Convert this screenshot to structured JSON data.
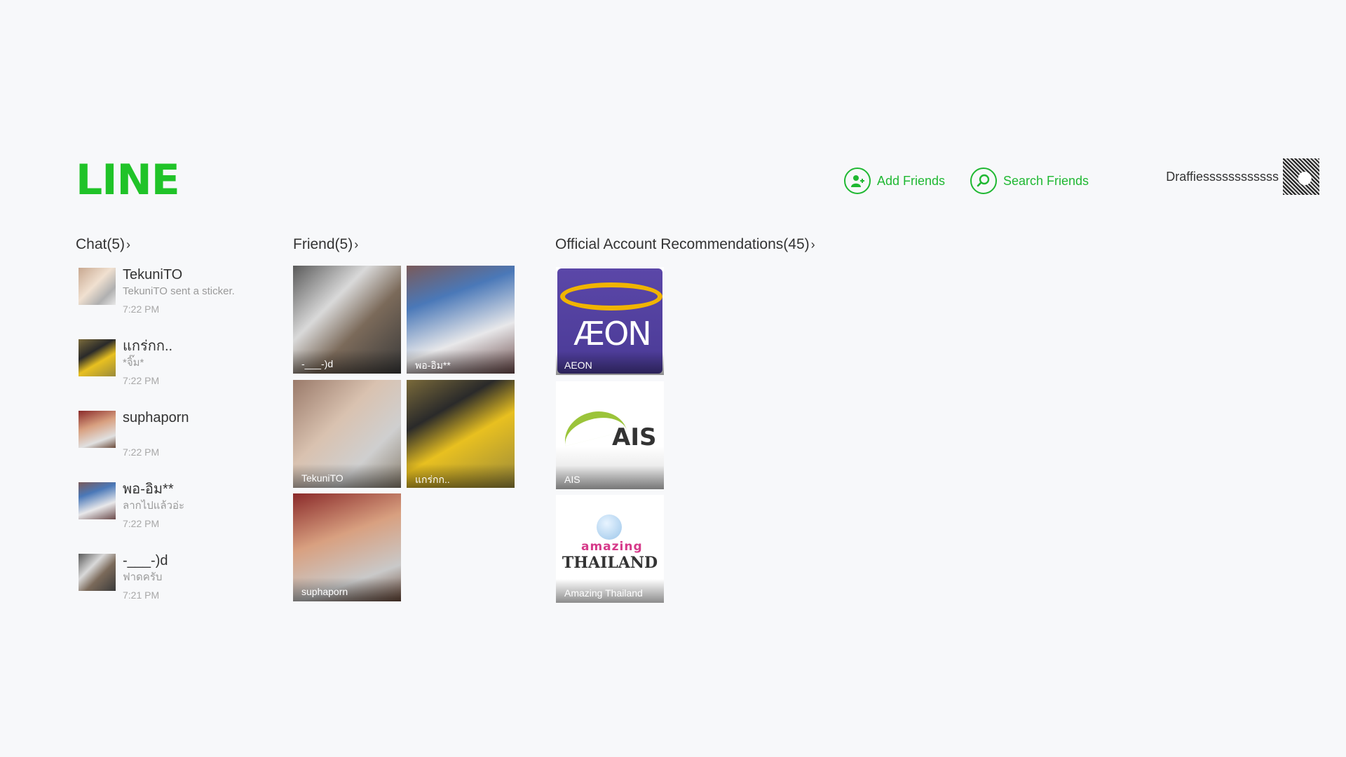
{
  "app": {
    "logo_text": "LINE"
  },
  "header": {
    "add_friends_label": "Add Friends",
    "search_friends_label": "Search Friends",
    "profile_name": "Draffiessssssssssss"
  },
  "sections": {
    "chat_title": "Chat(5)",
    "friend_title": "Friend(5)",
    "official_title": "Official Account Recommendations(45)"
  },
  "chats": [
    {
      "name": "TekuniTO",
      "preview": "TekuniTO sent a sticker.",
      "time": "7:22 PM"
    },
    {
      "name": "แกร่กก..",
      "preview": "*จิ๊ม*",
      "time": "7:22 PM"
    },
    {
      "name": "suphaporn",
      "preview": "",
      "time": "7:22 PM"
    },
    {
      "name": "พอ-อิม**",
      "preview": "ลากไปแล้วอ่ะ",
      "time": "7:22 PM"
    },
    {
      "name": "-___-)d",
      "preview": "ฟาดครับ",
      "time": "7:21 PM"
    }
  ],
  "friends": [
    {
      "name": "-___-)d"
    },
    {
      "name": "พอ-อิม**"
    },
    {
      "name": "TekuniTO"
    },
    {
      "name": "แกร่กก.."
    },
    {
      "name": "suphaporn"
    }
  ],
  "official_accounts": [
    {
      "name": "AEON",
      "logo_text": "ÆON"
    },
    {
      "name": "AIS",
      "logo_text": "AIS"
    },
    {
      "name": "Amazing Thailand",
      "logo_text_top": "amazing",
      "logo_text_bottom": "THAILAND"
    }
  ],
  "colors": {
    "brand_green": "#20c328",
    "background": "#f7f8fa"
  }
}
